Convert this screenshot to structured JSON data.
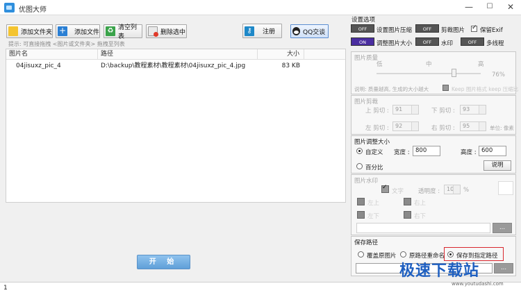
{
  "window": {
    "title": "优图大师",
    "minimize": "—",
    "maximize": "☐",
    "close": "✕"
  },
  "toolbar": {
    "add_folder": "添加文件夹",
    "add_file": "添加文件",
    "clear_list": "清空列表",
    "delete_selected": "删除选中",
    "register": "注册",
    "qq_chat": "QQ交谈"
  },
  "hint": "提示: 可直接拖拽 <图片或文件夹> 拖拽至列表",
  "file_list": {
    "columns": [
      "图片名",
      "路径",
      "大小"
    ],
    "rows": [
      {
        "name": "04jisuxz_pic_4",
        "path": "D:\\backup\\教程素材\\教程素材\\04jisuxz_pic_4.jpg",
        "size": "83 KB"
      }
    ]
  },
  "start_button": "开 始",
  "settings": {
    "title": "设置选项",
    "toggle_off": "OFF",
    "toggle_on": "ON",
    "compress": "设置图片压缩",
    "crop": "剪裁图片",
    "keep_exif": "保留Exif",
    "resize": "调整图片大小",
    "watermark": "水印",
    "multithread": "多线程"
  },
  "quality": {
    "title": "图片质量",
    "low": "低",
    "mid": "中",
    "high": "高",
    "value": "76%",
    "note": "说明: 质量越高, 生成的大小越大",
    "extra": "Keep 图片格式 keep 压缩比"
  },
  "crop": {
    "title": "图片剪裁",
    "top_label": "上 剪切 :",
    "top_value": "91",
    "bottom_label": "下 剪切 :",
    "bottom_value": "93",
    "left_label": "左 剪切 :",
    "left_value": "92",
    "right_label": "右 剪切 :",
    "right_value": "95",
    "unit": "单位: 像素"
  },
  "resize": {
    "title": "图片调整大小",
    "custom": "自定义",
    "width_label": "宽度 :",
    "width_value": "800",
    "height_label": "高度 :",
    "height_value": "600",
    "percent": "百分比",
    "explain": "说明"
  },
  "watermark": {
    "title": "图片水印",
    "text_label": "文字",
    "opacity_label": "透明度 :",
    "opacity_value": "100",
    "opacity_unit": "%",
    "opt1": "左上",
    "opt2": "右上",
    "opt3": "左下",
    "opt4": "右下",
    "browse": "..."
  },
  "save": {
    "title": "保存路径",
    "overwrite": "覆盖原图片",
    "rename": "原路径重命名",
    "custom": "保存到指定路径",
    "browse": "..."
  },
  "status": {
    "count": "1"
  },
  "watermark_brand": {
    "logo": "极速下载站",
    "url": "www.youtudashi.com"
  },
  "colors": {
    "accent": "#4a2ea0",
    "start": "#6aa8df",
    "highlight_box": "#d9272e"
  }
}
